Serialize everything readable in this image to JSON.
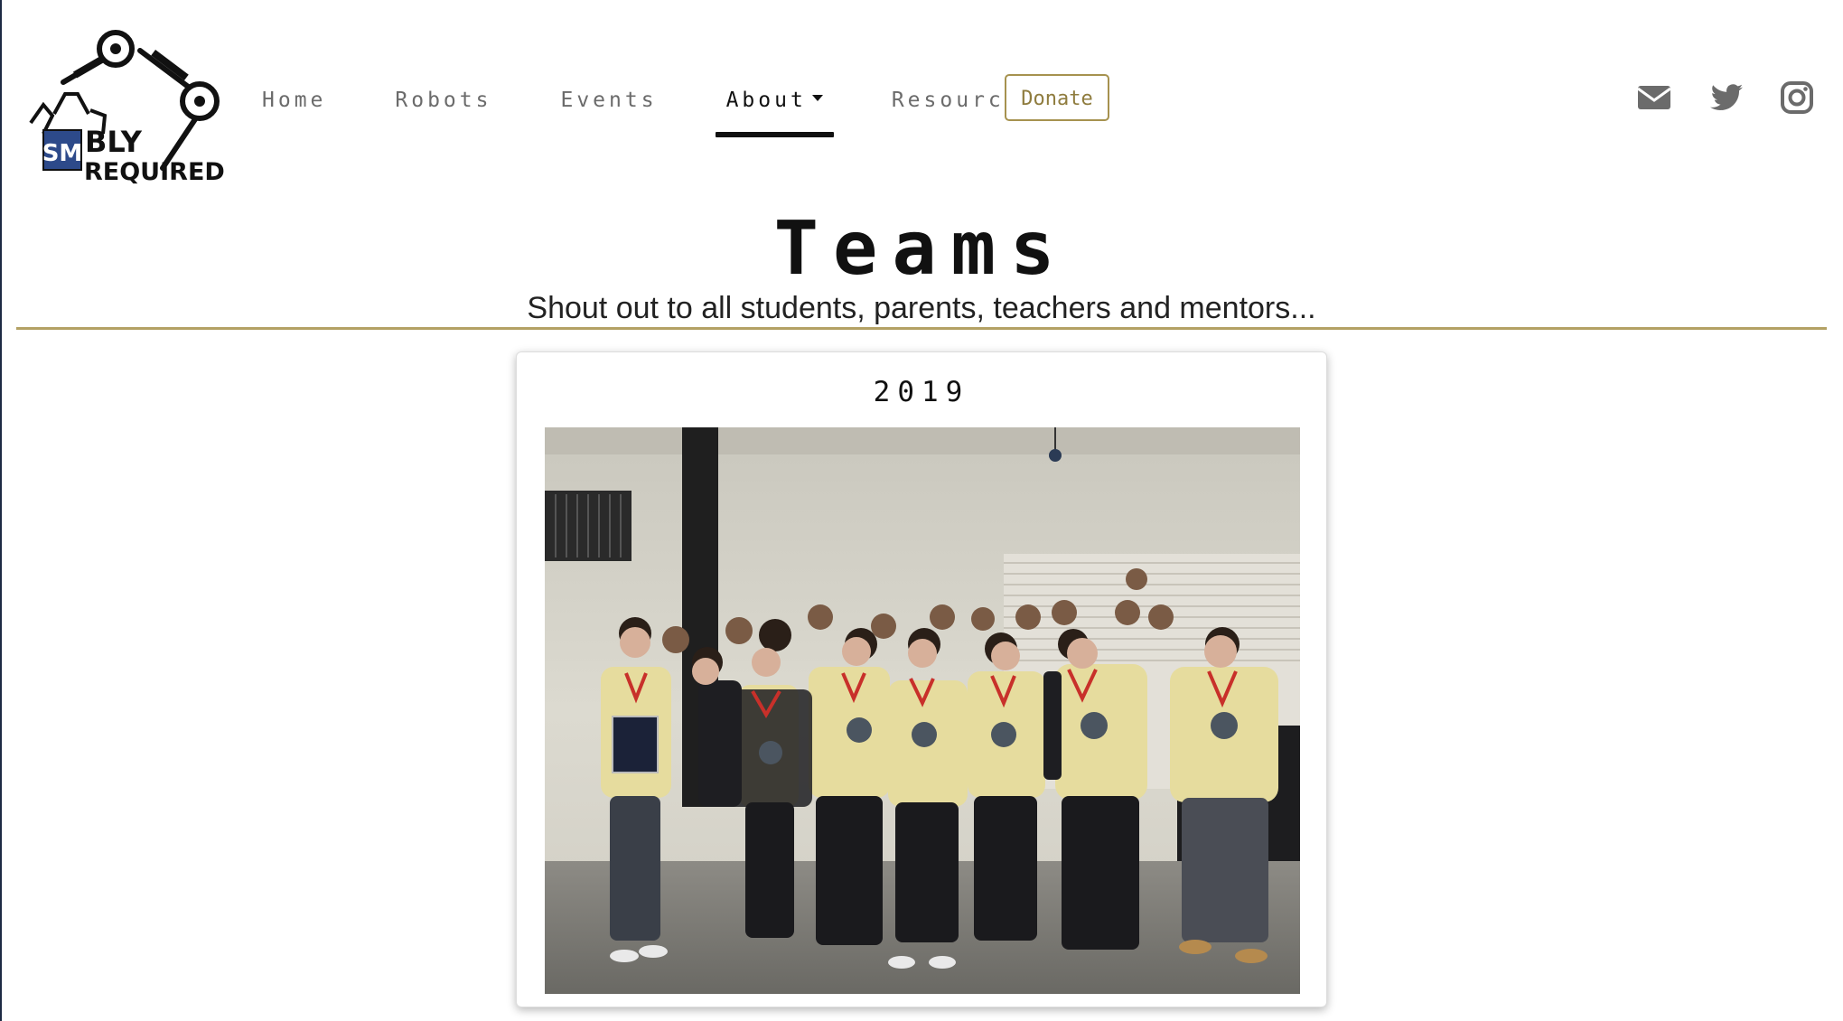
{
  "logo": {
    "text_line1": "BLY",
    "text_line2": "REQUIRED",
    "monogram": "SM"
  },
  "nav": {
    "items": [
      {
        "label": "Home",
        "dropdown": false,
        "active": false
      },
      {
        "label": "Robots",
        "dropdown": false,
        "active": false
      },
      {
        "label": "Events",
        "dropdown": false,
        "active": false
      },
      {
        "label": "About",
        "dropdown": true,
        "active": true
      },
      {
        "label": "Resources",
        "dropdown": true,
        "active": false
      }
    ],
    "donate_label": "Donate"
  },
  "social": {
    "icons": [
      "envelope-icon",
      "twitter-icon",
      "instagram-icon"
    ],
    "color": "#6b6b6b"
  },
  "page": {
    "title": "Teams",
    "subtitle": "Shout out to all students, parents, teachers and mentors..."
  },
  "card": {
    "year": "2019"
  },
  "colors": {
    "accent_gold": "#b3a164",
    "donate_text": "#8f7c3e",
    "nav_text": "#6b6b6b",
    "active_text": "#111111"
  }
}
